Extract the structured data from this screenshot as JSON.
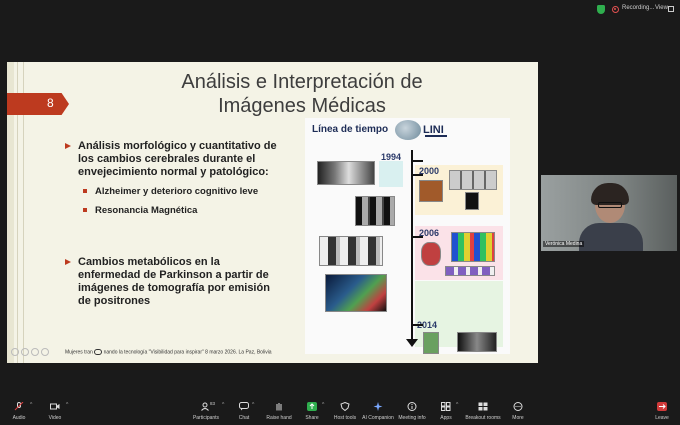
{
  "topbar": {
    "recording_label": "Recording...",
    "view_label": "View"
  },
  "slide": {
    "title_line1": "Análisis e Interpretación de",
    "title_line2": "Imágenes Médicas",
    "page_number": "8",
    "bullets": [
      {
        "text_l1": "Análisis morfológico y cuantitativo de",
        "text_l2": "los cambios cerebrales durante el",
        "text_l3": "envejecimiento normal y patológico:"
      },
      {
        "text_l1": "Cambios metabólicos en la",
        "text_l2": "enfermedad de Parkinson a partir de",
        "text_l3": "imágenes de tomografía por emisión",
        "text_l4": "de positrones"
      }
    ],
    "subbullets": [
      "Alzheimer y deterioro cognitivo leve",
      "Resonancia Magnética"
    ],
    "footer_a": "Mujeres tran",
    "footer_b": "nando la tecnología \"Visibilidad para inspirar\" 8 marzo 2026. La Paz, Bolivia",
    "figure": {
      "title": "Línea de tiempo",
      "logo": "LINI",
      "years": [
        "1994",
        "2000",
        "2006",
        "2014"
      ]
    }
  },
  "camera": {
    "name": "Verónica Medina"
  },
  "toolbar": {
    "audio": "Audio",
    "video": "Video",
    "participants": "Participants",
    "participants_count": "83",
    "chat": "Chat",
    "raise_hand": "Raise hand",
    "share": "Share",
    "host_tools": "Host tools",
    "ai_companion": "AI Companion",
    "meeting_info": "Meeting info",
    "apps": "Apps",
    "breakout_rooms": "Breakout rooms",
    "more": "More",
    "leave": "Leave"
  },
  "colors": {
    "accent_red": "#bd3a1f",
    "share_green": "#2fae4e",
    "background": "#1a1a1a"
  }
}
